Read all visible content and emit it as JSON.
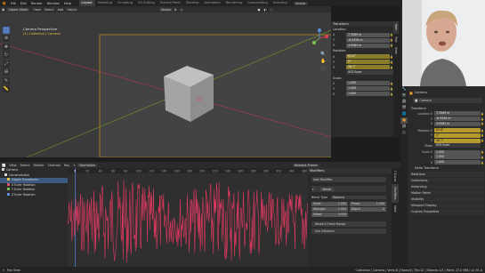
{
  "topbar": {
    "menus": [
      "File",
      "Edit",
      "Render",
      "Window",
      "Help"
    ],
    "workspaces": [
      "Layout",
      "Modeling",
      "Sculpting",
      "UV Editing",
      "Texture Paint",
      "Shading",
      "Animation",
      "Rendering",
      "Compositing",
      "Scripting"
    ],
    "active_workspace": "Layout",
    "scene_label": "Scene"
  },
  "viewport": {
    "header": {
      "mode": "Object Mode",
      "menus": [
        "View",
        "Select",
        "Add",
        "Object"
      ],
      "transform_orientation": "Global"
    },
    "overlay_title": "Camera Perspective",
    "overlay_subtitle": "(1) Collection | Camera",
    "colors": {
      "bg": "#3a3a3a",
      "camera_frame": "#b58a1f",
      "cube": "#a9a9a9",
      "x_axis": "#b23a4a",
      "y_axis": "#6f9a2a"
    }
  },
  "toolbar_icons": [
    "cursor-icon",
    "cursor-3d-icon",
    "move-icon",
    "rotate-icon",
    "scale-icon",
    "transform-icon",
    "annotate-icon",
    "measure-icon"
  ],
  "npanel": {
    "title": "Transform",
    "location_label": "Location:",
    "location": [
      {
        "axis": "X",
        "value": "7.3589 m"
      },
      {
        "axis": "Y",
        "value": "-6.9258 m"
      },
      {
        "axis": "Z",
        "value": "4.9583 m"
      }
    ],
    "rotation_label": "Rotation:",
    "rotation": [
      {
        "axis": "X",
        "value": "63.6°"
      },
      {
        "axis": "Y",
        "value": "0°"
      },
      {
        "axis": "Z",
        "value": "46.7°"
      }
    ],
    "rotation_mode": "XYZ Euler",
    "scale_label": "Scale:",
    "scale": [
      {
        "axis": "X",
        "value": "1.000"
      },
      {
        "axis": "Y",
        "value": "1.000"
      },
      {
        "axis": "Z",
        "value": "1.000"
      }
    ],
    "tabs": [
      "Item",
      "Tool",
      "View"
    ]
  },
  "graph": {
    "header_menus": [
      "View",
      "Select",
      "Marker",
      "Channel",
      "Key"
    ],
    "normalize_label": "Normalize",
    "interpolation": "Nearest Frame",
    "frame_ticks": [
      "0",
      "20",
      "40",
      "60",
      "80",
      "100",
      "120",
      "140",
      "160",
      "180",
      "200",
      "220",
      "240",
      "260",
      "280",
      "300",
      "320",
      "340",
      "360"
    ],
    "current_frame": "2",
    "channels": [
      {
        "name": "Camera",
        "color": "#d8d8d8"
      },
      {
        "name": "CameraAction",
        "color": "#d8d8d8"
      },
      {
        "name": "Object Transforms",
        "color": "#e8c040"
      },
      {
        "name": "X Euler Rotation",
        "color": "#e8506a"
      },
      {
        "name": "Y Euler Rotation",
        "color": "#7ac24a"
      },
      {
        "name": "Z Euler Rotation",
        "color": "#5a8ee0"
      }
    ],
    "curve_color": "#ec3a63"
  },
  "modifiers": {
    "title": "Modifiers",
    "add_label": "Add Modifier",
    "noise_label": "Noise",
    "blend_type_label": "Blend Type",
    "blend_type_value": "Replace",
    "scale_label": "Scale",
    "scale_value": "1.000",
    "phase_label": "Phase",
    "phase_value": "1.000",
    "strength_label": "Strength",
    "strength_value": "1.000",
    "depth_label": "Depth",
    "depth_value": "0",
    "offset_label": "Offset",
    "offset_value": "0.000",
    "restrict_label": "Restrict Frame Range",
    "influence_label": "Use Influence",
    "tabs": [
      "F-Curve",
      "Modifiers",
      "View"
    ]
  },
  "outliner": {
    "items": [
      "Scene Collection",
      "Collection",
      "Camera",
      "Cube",
      "Light"
    ]
  },
  "properties": {
    "object_name": "Camera",
    "data_name": "Camera",
    "transform_label": "Transform",
    "location_label": "Location X",
    "loc": [
      "7.3589 m",
      "-6.9258 m",
      "4.9583 m"
    ],
    "rotation_label": "Rotation X",
    "rot": [
      "63.6°",
      "0°",
      "46.7°"
    ],
    "mode_label": "Mode",
    "mode_value": "XYZ Euler",
    "scale_label": "Scale X",
    "scl": [
      "1.000",
      "1.000",
      "1.000"
    ],
    "sections": [
      "Delta Transform",
      "Relations",
      "Collections",
      "Instancing",
      "Motion Paths",
      "Visibility",
      "Viewport Display",
      "Custom Properties"
    ]
  },
  "statusbar": {
    "left": "Pan View",
    "right": "Collection | Camera | Verts:8 | Faces:6 | Tris:12 | Objects:1/3 | Mem: 27.0 MiB | v2.91.0"
  }
}
